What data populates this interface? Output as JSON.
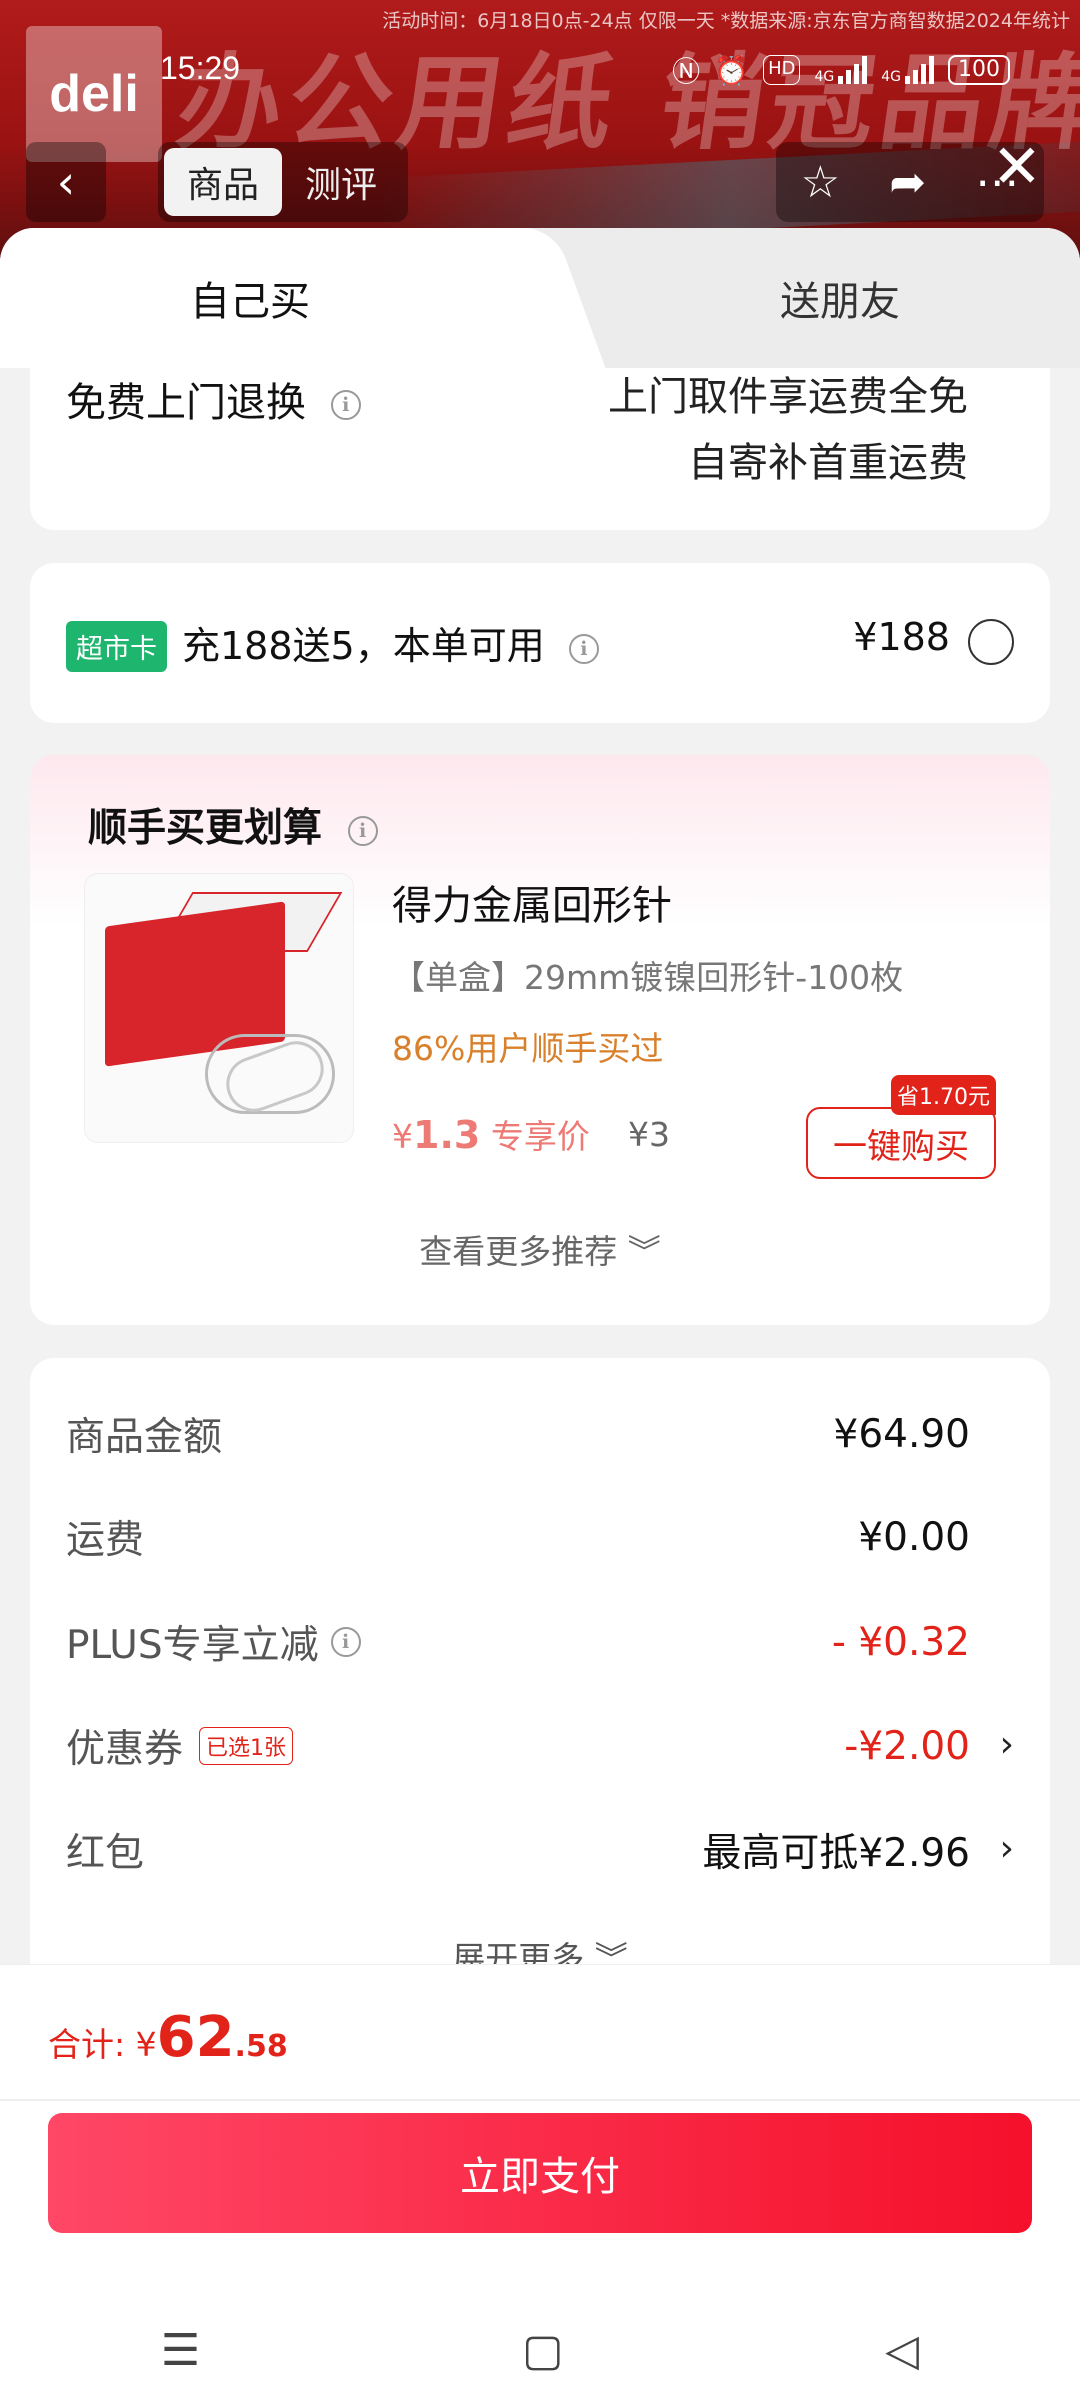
{
  "status_bar": {
    "time": "15:29",
    "network_a": "4G",
    "network_b": "4G",
    "hd": "HD",
    "battery": "100"
  },
  "banner": {
    "note": "活动时间：6月18日0点-24点 仅限一天 *数据来源:京东官方商智数据2024年统计",
    "slogan": "办公用纸 销冠品牌",
    "brand": "deli"
  },
  "nav": {
    "tabs": [
      "商品",
      "测评"
    ]
  },
  "mode_tabs": {
    "self": "自己买",
    "friend": "送朋友"
  },
  "return_service": {
    "label": "免费上门退换",
    "line1": "上门取件享运费全免",
    "line2": "自寄补首重运费"
  },
  "supermarket_card": {
    "badge": "超市卡",
    "text": "充188送5，本单可用",
    "price": "¥188"
  },
  "recommend": {
    "title": "顺手买更划算",
    "product": {
      "name": "得力金属回形针",
      "spec": "【单盒】29mm镀镍回形针-100枚",
      "percent_text": "86%用户顺手买过",
      "price_prefix": "¥",
      "price": "1.3",
      "price_label": "专享价",
      "orig_price": "¥3",
      "buy_label": "一键购买",
      "save_label": "省1.70元"
    },
    "more_label": "查看更多推荐"
  },
  "summary": {
    "rows": [
      {
        "label": "商品金额",
        "value": "¥64.90"
      },
      {
        "label": "运费",
        "value": "¥0.00"
      },
      {
        "label": "PLUS专享立减",
        "value": "- ¥0.32"
      },
      {
        "label": "优惠券",
        "tag": "已选1张",
        "value": "-¥2.00"
      },
      {
        "label": "红包",
        "value": "最高可抵¥2.96"
      }
    ],
    "expand_label": "展开更多"
  },
  "footer": {
    "total_label": "合计: ¥",
    "total_int": "62",
    "total_dec": ".58",
    "pay_label": "立即支付"
  },
  "colors": {
    "accent": "#e2231a",
    "green_badge": "#1eb56f",
    "banner_red": "#b11b1b"
  }
}
